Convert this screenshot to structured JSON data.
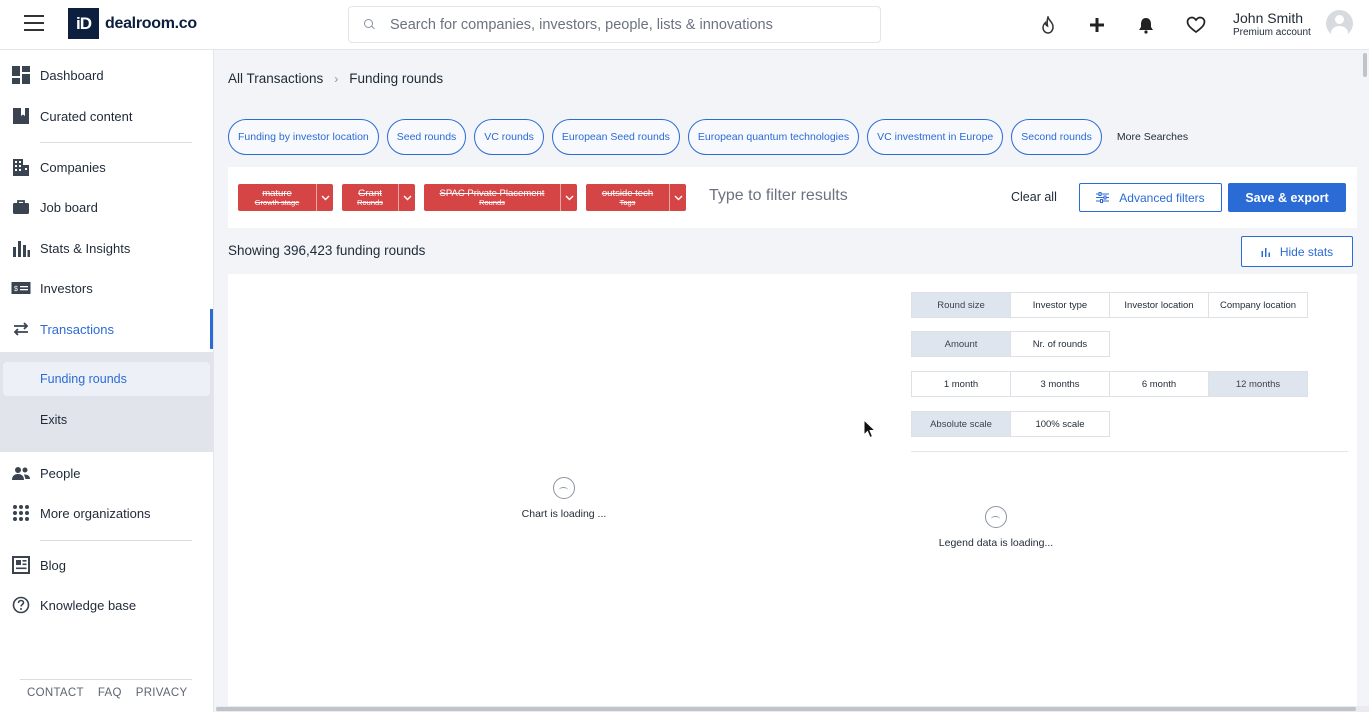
{
  "app": {
    "logo_mark": "iD",
    "logo_text": "dealroom.co"
  },
  "search": {
    "placeholder": "Search for companies, investors, people, lists & innovations"
  },
  "header_icons": [
    "flame-icon",
    "plus-icon",
    "bell-icon",
    "heart-icon"
  ],
  "user": {
    "name": "John Smith",
    "plan": "Premium account"
  },
  "sidebar": {
    "items": [
      {
        "label": "Dashboard",
        "icon": "dashboard-icon"
      },
      {
        "label": "Curated content",
        "icon": "bookmark-icon"
      },
      {
        "label": "Companies",
        "icon": "building-icon"
      },
      {
        "label": "Job board",
        "icon": "briefcase-icon"
      },
      {
        "label": "Stats & Insights",
        "icon": "bar-chart-icon"
      },
      {
        "label": "Investors",
        "icon": "money-icon"
      },
      {
        "label": "Transactions",
        "icon": "arrows-icon"
      },
      {
        "label": "People",
        "icon": "people-icon"
      },
      {
        "label": "More organizations",
        "icon": "grid-icon"
      },
      {
        "label": "Blog",
        "icon": "blog-icon"
      },
      {
        "label": "Knowledge base",
        "icon": "question-icon"
      }
    ],
    "sub_items": [
      {
        "label": "Funding rounds"
      },
      {
        "label": "Exits"
      }
    ],
    "footer": [
      "CONTACT",
      "FAQ",
      "PRIVACY"
    ]
  },
  "breadcrumb": {
    "root": "All Transactions",
    "current": "Funding rounds"
  },
  "chips": [
    "Funding by investor location",
    "Seed rounds",
    "VC rounds",
    "European Seed rounds",
    "European quantum technologies",
    "VC investment in Europe",
    "Second rounds"
  ],
  "more_searches": "More Searches",
  "filter_tags": [
    {
      "line1": "mature",
      "line2": "Growth stage"
    },
    {
      "line1": "Grant",
      "line2": "Rounds"
    },
    {
      "line1": "SPAC Private Placement",
      "line2": "Rounds"
    },
    {
      "line1": "outside tech",
      "line2": "Tags"
    }
  ],
  "filter": {
    "placeholder": "Type to filter results",
    "clear_all": "Clear all",
    "advanced": "Advanced filters",
    "save_export": "Save & export"
  },
  "results": {
    "showing": "Showing 396,423 funding rounds",
    "hide_stats": "Hide stats"
  },
  "stats": {
    "group_by": [
      "Round size",
      "Investor type",
      "Investor location",
      "Company location"
    ],
    "metric": [
      "Amount",
      "Nr. of rounds"
    ],
    "period": [
      "1 month",
      "3 months",
      "6 month",
      "12 months"
    ],
    "scale": [
      "Absolute scale",
      "100% scale"
    ],
    "chart_loading": "Chart is loading ...",
    "legend_loading": "Legend data is loading..."
  },
  "colors": {
    "accent": "#2b6bd6",
    "tag_red": "#d64545",
    "brand_dark": "#0c1f3f"
  }
}
